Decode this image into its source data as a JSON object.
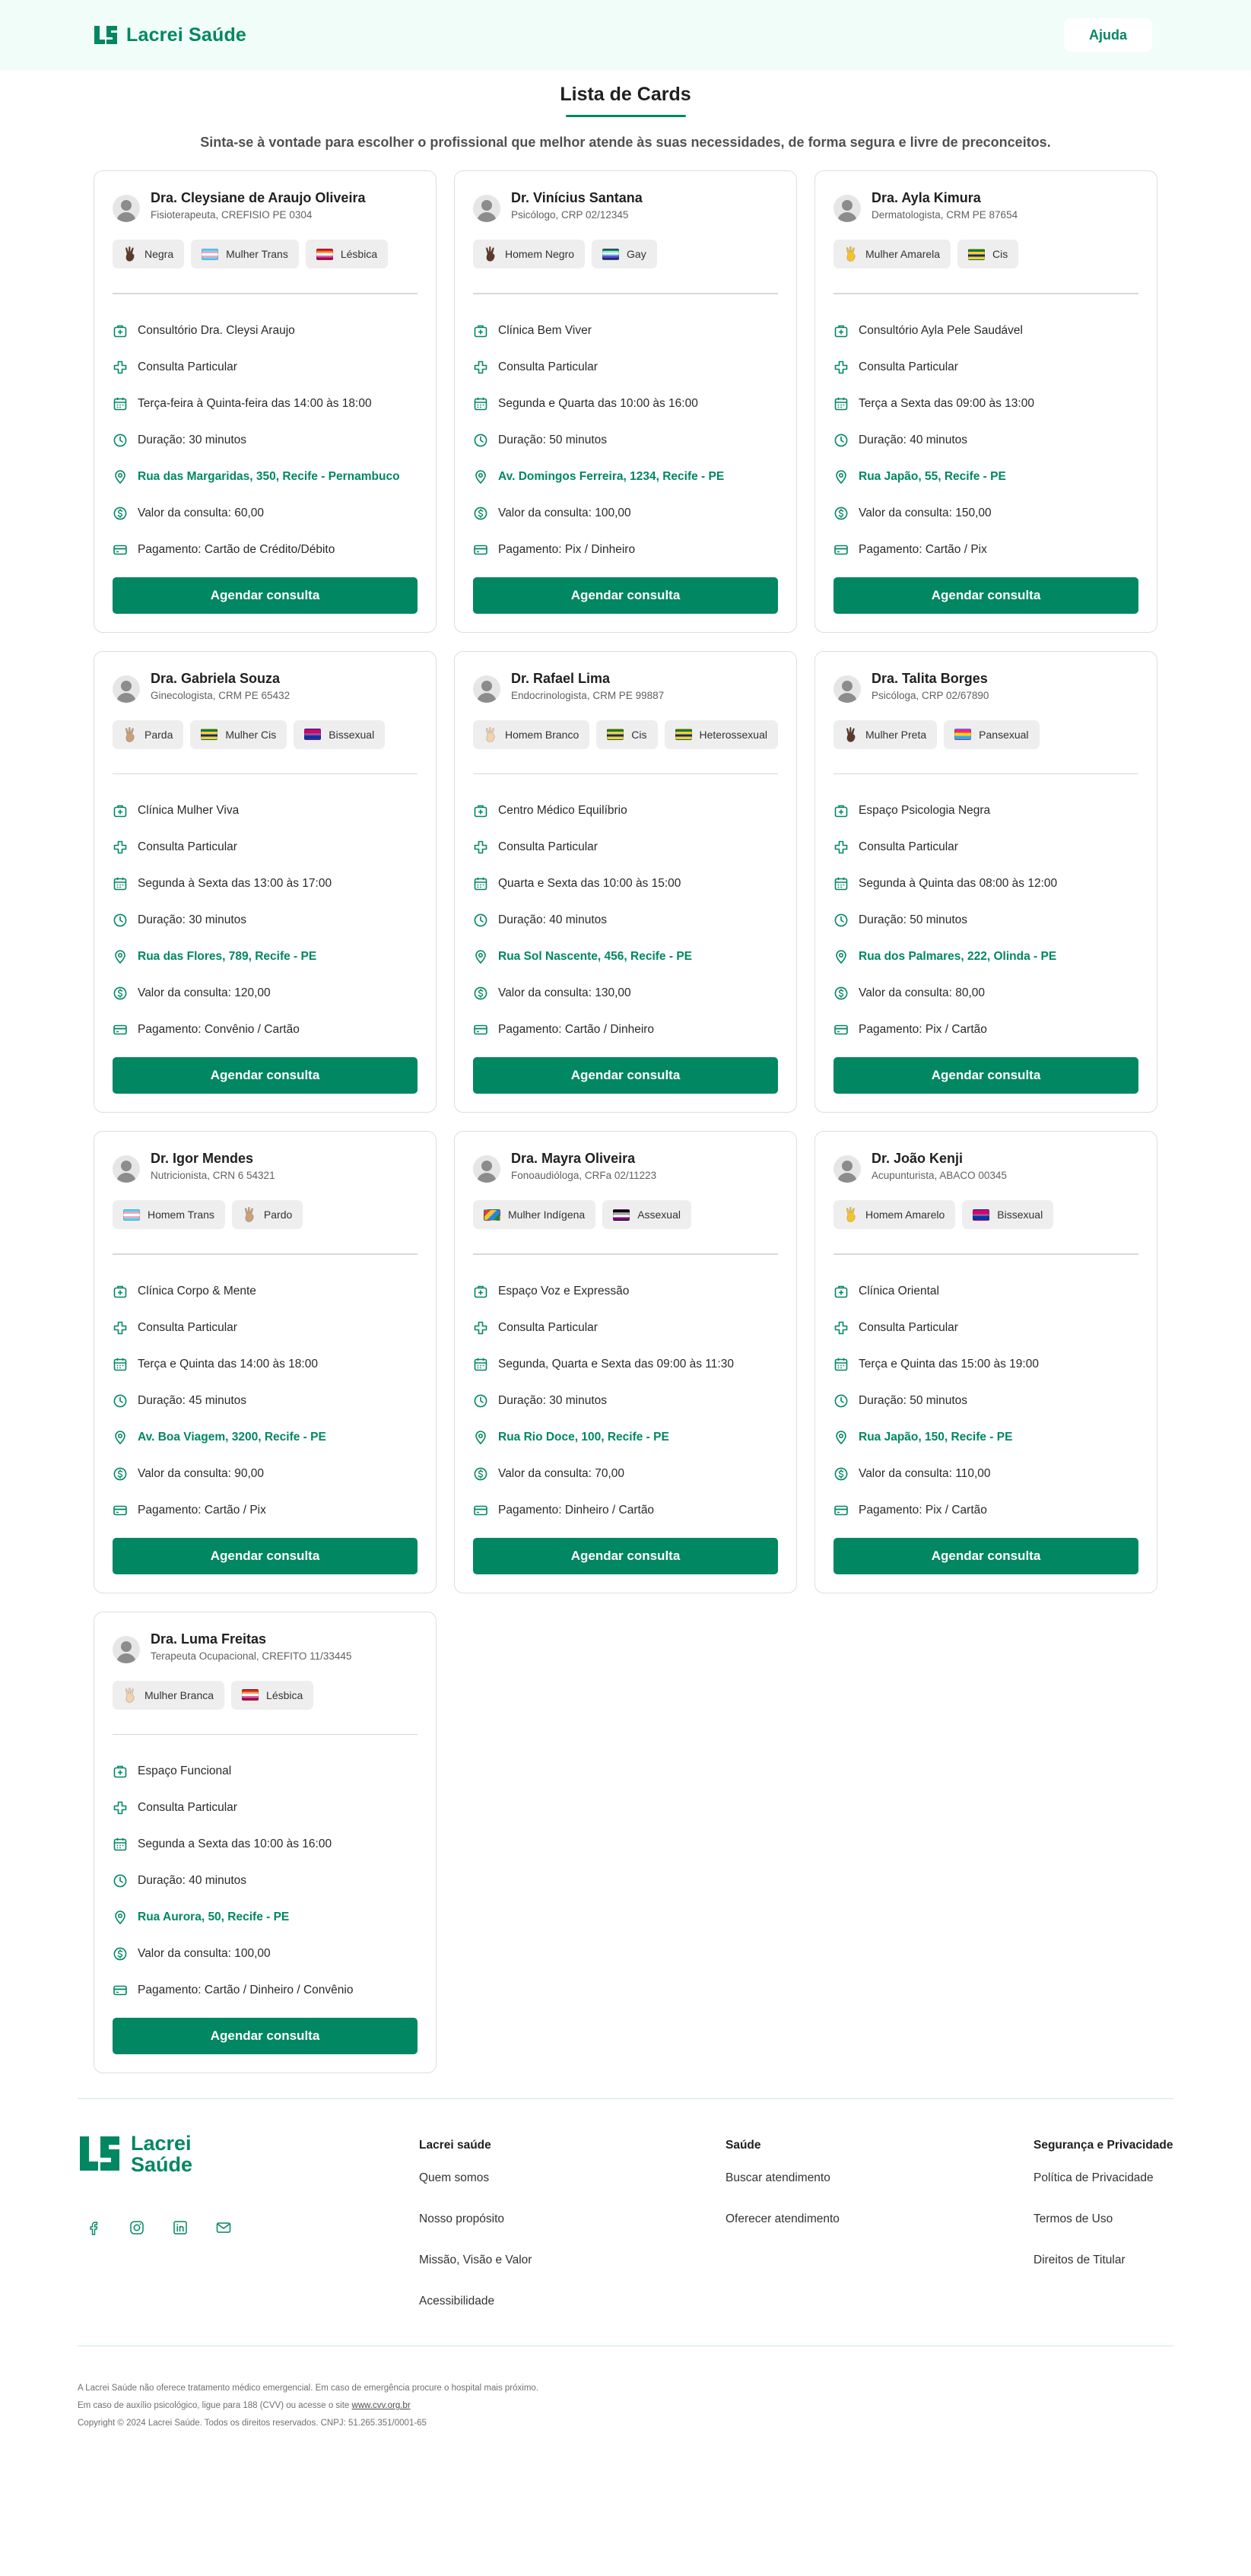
{
  "header": {
    "brand": "Lacrei Saúde",
    "help": "Ajuda"
  },
  "page": {
    "title": "Lista de Cards",
    "subtitle": "Sinta-se à vontade para escolher o profissional que melhor atende às suas necessidades, de forma segura e livre de preconceitos."
  },
  "book_label": "Agendar consulta",
  "cards": [
    {
      "name": "Dra. Cleysiane de Araujo Oliveira",
      "specialty": "Fisioterapeuta, CREFISIO PE 0304",
      "tags": [
        {
          "label": "Negra",
          "icon": "hand-dark-icon"
        },
        {
          "label": "Mulher Trans",
          "icon": "trans-flag-icon"
        },
        {
          "label": "Lésbica",
          "icon": "lesbian-flag-icon"
        }
      ],
      "place": "Consultório Dra. Cleysi Araujo",
      "type": "Consulta Particular",
      "schedule": "Terça-feira à Quinta-feira das 14:00 às 18:00",
      "duration": "Duração: 30 minutos",
      "address": "Rua das Margaridas, 350, Recife - Pernambuco",
      "price": "Valor da consulta: 60,00",
      "payment": "Pagamento: Cartão de Crédito/Débito"
    },
    {
      "name": "Dr. Vinícius Santana",
      "specialty": "Psicólogo, CRP 02/12345",
      "tags": [
        {
          "label": "Homem Negro",
          "icon": "hand-dark-icon"
        },
        {
          "label": "Gay",
          "icon": "gay-flag-icon"
        }
      ],
      "place": "Clínica Bem Viver",
      "type": "Consulta Particular",
      "schedule": "Segunda e Quarta das 10:00 às 16:00",
      "duration": "Duração: 50 minutos",
      "address": "Av. Domingos Ferreira, 1234, Recife - PE",
      "price": "Valor da consulta: 100,00",
      "payment": "Pagamento: Pix / Dinheiro"
    },
    {
      "name": "Dra. Ayla Kimura",
      "specialty": "Dermatologista, CRM PE 87654",
      "tags": [
        {
          "label": "Mulher Amarela",
          "icon": "hand-yellow-icon"
        },
        {
          "label": "Cis",
          "icon": "cis-flag-icon"
        }
      ],
      "place": "Consultório Ayla Pele Saudável",
      "type": "Consulta Particular",
      "schedule": "Terça a Sexta das 09:00 às 13:00",
      "duration": "Duração: 40 minutos",
      "address": "Rua Japão, 55, Recife - PE",
      "price": "Valor da consulta: 150,00",
      "payment": "Pagamento: Cartão / Pix"
    },
    {
      "name": "Dra. Gabriela Souza",
      "specialty": "Ginecologista, CRM PE 65432",
      "tags": [
        {
          "label": "Parda",
          "icon": "hand-medium-icon"
        },
        {
          "label": "Mulher Cis",
          "icon": "cis-flag-icon"
        },
        {
          "label": "Bissexual",
          "icon": "bi-flag-icon"
        }
      ],
      "place": "Clínica Mulher Viva",
      "type": "Consulta Particular",
      "schedule": "Segunda à Sexta das 13:00 às 17:00",
      "duration": "Duração: 30 minutos",
      "address": "Rua das Flores, 789, Recife - PE",
      "price": "Valor da consulta: 120,00",
      "payment": "Pagamento: Convênio / Cartão"
    },
    {
      "name": "Dr. Rafael Lima",
      "specialty": "Endocrinologista, CRM PE 99887",
      "tags": [
        {
          "label": "Homem Branco",
          "icon": "hand-light-icon"
        },
        {
          "label": "Cis",
          "icon": "cis-flag-icon"
        },
        {
          "label": "Heterossexual",
          "icon": "hetero-flag-icon"
        }
      ],
      "place": "Centro Médico Equilíbrio",
      "type": "Consulta Particular",
      "schedule": "Quarta e Sexta das 10:00 às 15:00",
      "duration": "Duração: 40 minutos",
      "address": "Rua Sol Nascente, 456, Recife - PE",
      "price": "Valor da consulta: 130,00",
      "payment": "Pagamento: Cartão / Dinheiro"
    },
    {
      "name": "Dra. Talita Borges",
      "specialty": "Psicóloga, CRP 02/67890",
      "tags": [
        {
          "label": "Mulher Preta",
          "icon": "hand-dark-icon"
        },
        {
          "label": "Pansexual",
          "icon": "pan-flag-icon"
        }
      ],
      "place": "Espaço Psicologia Negra",
      "type": "Consulta Particular",
      "schedule": "Segunda à Quinta das 08:00 às 12:00",
      "duration": "Duração: 50 minutos",
      "address": "Rua dos Palmares, 222, Olinda - PE",
      "price": "Valor da consulta: 80,00",
      "payment": "Pagamento: Pix / Cartão"
    },
    {
      "name": "Dr. Igor Mendes",
      "specialty": "Nutricionista, CRN 6 54321",
      "tags": [
        {
          "label": "Homem Trans",
          "icon": "trans-flag-icon"
        },
        {
          "label": "Pardo",
          "icon": "hand-medium-icon"
        }
      ],
      "place": "Clínica Corpo & Mente",
      "type": "Consulta Particular",
      "schedule": "Terça e Quinta das 14:00 às 18:00",
      "duration": "Duração: 45 minutos",
      "address": "Av. Boa Viagem, 3200, Recife - PE",
      "price": "Valor da consulta: 90,00",
      "payment": "Pagamento: Cartão / Pix"
    },
    {
      "name": "Dra. Mayra Oliveira",
      "specialty": "Fonoaudióloga, CRFa 02/11223",
      "tags": [
        {
          "label": "Mulher Indígena",
          "icon": "indigenous-flag-icon"
        },
        {
          "label": "Assexual",
          "icon": "ace-flag-icon"
        }
      ],
      "place": "Espaço Voz e Expressão",
      "type": "Consulta Particular",
      "schedule": "Segunda, Quarta e Sexta das 09:00 às 11:30",
      "duration": "Duração: 30 minutos",
      "address": "Rua Rio Doce, 100, Recife - PE",
      "price": "Valor da consulta: 70,00",
      "payment": "Pagamento: Dinheiro / Cartão"
    },
    {
      "name": "Dr. João Kenji",
      "specialty": "Acupunturista, ABACO 00345",
      "tags": [
        {
          "label": "Homem Amarelo",
          "icon": "hand-yellow-icon"
        },
        {
          "label": "Bissexual",
          "icon": "bi-flag-icon"
        }
      ],
      "place": "Clínica Oriental",
      "type": "Consulta Particular",
      "schedule": "Terça e Quinta das 15:00 às 19:00",
      "duration": "Duração: 50 minutos",
      "address": "Rua Japão, 150, Recife - PE",
      "price": "Valor da consulta: 110,00",
      "payment": "Pagamento: Pix / Cartão"
    },
    {
      "name": "Dra. Luma Freitas",
      "specialty": "Terapeuta Ocupacional, CREFITO 11/33445",
      "tags": [
        {
          "label": "Mulher Branca",
          "icon": "hand-light-icon"
        },
        {
          "label": "Lésbica",
          "icon": "lesbian-flag-icon"
        }
      ],
      "place": "Espaço Funcional",
      "type": "Consulta Particular",
      "schedule": "Segunda a Sexta das 10:00 às 16:00",
      "duration": "Duração: 40 minutos",
      "address": "Rua Aurora, 50, Recife - PE",
      "price": "Valor da consulta: 100,00",
      "payment": "Pagamento: Cartão / Dinheiro / Convênio"
    }
  ],
  "footer": {
    "brand_line1": "Lacrei",
    "brand_line2": "Saúde",
    "socials": [
      "facebook-icon",
      "instagram-icon",
      "linkedin-icon",
      "mail-icon"
    ],
    "columns": [
      {
        "title": "Lacrei saúde",
        "links": [
          "Quem somos",
          "Nosso propósito",
          "Missão, Visão e Valor",
          "Acessibilidade"
        ]
      },
      {
        "title": "Saúde",
        "links": [
          "Buscar atendimento",
          "Oferecer atendimento"
        ]
      },
      {
        "title": "Segurança e Privacidade",
        "links": [
          "Política de Privacidade",
          "Termos de Uso",
          "Direitos de Titular"
        ]
      }
    ],
    "legal1": "A Lacrei Saúde não oferece tratamento médico emergencial. Em caso de emergência procure o hospital mais próximo.",
    "legal2": "Em caso de auxílio psicológico, ligue para 188 (CVV) ou acesse o site",
    "legal2_link": "www.cvv.org.br",
    "legal3": "Copyright © 2024 Lacrei Saúde. Todos os direitos reservados. CNPJ: 51.265.351/0001-65"
  },
  "colors": {
    "brand": "#018762",
    "header_bg": "#f1fdf8"
  }
}
